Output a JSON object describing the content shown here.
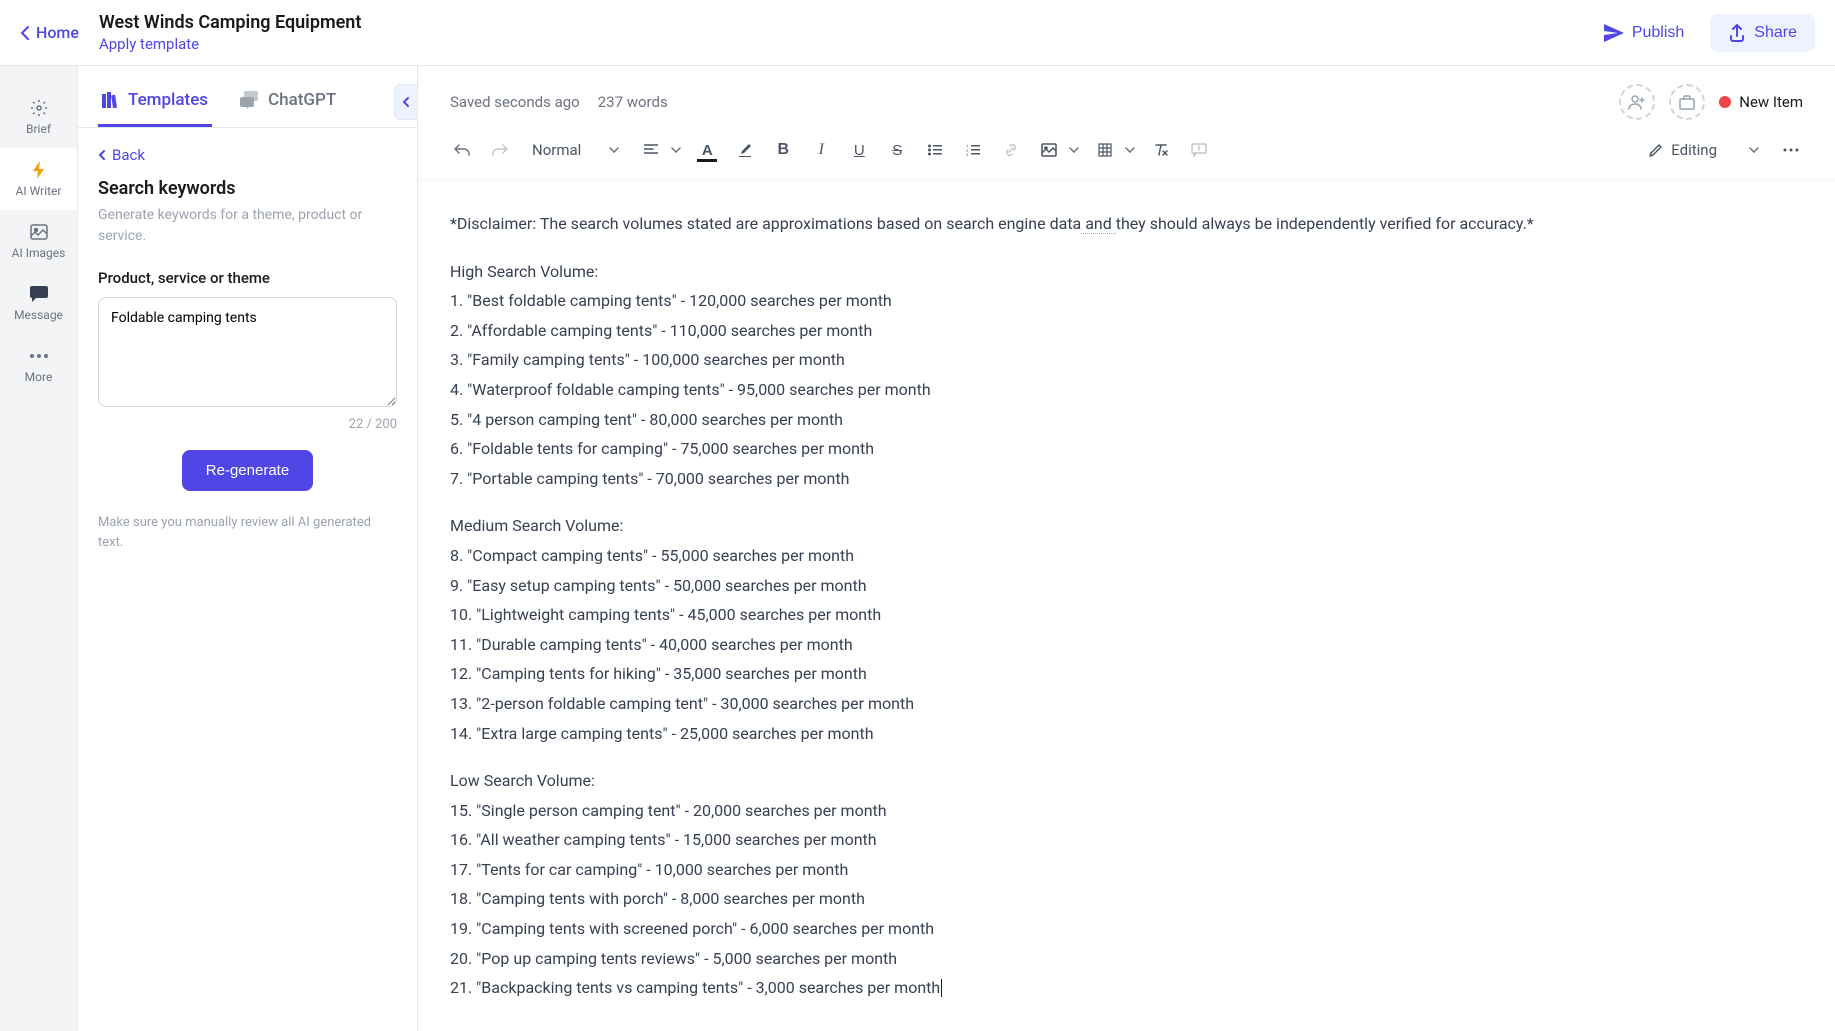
{
  "header": {
    "home": "Home",
    "title": "West Winds Camping Equipment",
    "apply_template": "Apply template",
    "publish": "Publish",
    "share": "Share"
  },
  "rail": {
    "brief": "Brief",
    "ai_writer": "AI Writer",
    "ai_images": "AI Images",
    "message": "Message",
    "more": "More"
  },
  "panel": {
    "tabs": {
      "templates": "Templates",
      "chatgpt": "ChatGPT"
    },
    "back": "Back",
    "section_title": "Search keywords",
    "section_desc": "Generate keywords for a theme, product or service.",
    "input_label": "Product, service or theme",
    "input_value": "Foldable camping tents",
    "char_count": "22 / 200",
    "regenerate": "Re-generate",
    "review_note": "Make sure you manually review all AI generated text."
  },
  "editor": {
    "saved_status": "Saved seconds ago",
    "word_count": "237 words",
    "new_item": "New Item",
    "style_select": "Normal",
    "mode": "Editing"
  },
  "content": {
    "disclaimer_a": "*Disclaimer: The search volumes stated are approximations based on search engine data",
    "disclaimer_mid": " and ",
    "disclaimer_b": "they should always be independently verified for accuracy.*",
    "high_heading": "High Search Volume:",
    "high": [
      "1. \"Best foldable camping tents\" - 120,000 searches per month",
      "2. \"Affordable camping tents\" - 110,000 searches per month",
      "3. \"Family camping tents\" - 100,000 searches per month",
      "4. \"Waterproof foldable camping tents\" - 95,000 searches per month",
      "5. \"4 person camping tent\" - 80,000 searches per month",
      "6. \"Foldable tents for camping\" - 75,000 searches per month",
      "7. \"Portable camping tents\" - 70,000 searches per month"
    ],
    "medium_heading": "Medium Search Volume:",
    "medium": [
      "8. \"Compact camping tents\" - 55,000 searches per month",
      "9. \"Easy setup camping tents\" - 50,000 searches per month",
      "10. \"Lightweight camping tents\" - 45,000 searches per month",
      "11. \"Durable camping tents\" - 40,000 searches per month",
      "12. \"Camping tents for hiking\" - 35,000 searches per month",
      "13. \"2-person foldable camping tent\" - 30,000 searches per month",
      "14. \"Extra large camping tents\" - 25,000 searches per month"
    ],
    "low_heading": "Low Search Volume:",
    "low": [
      "15. \"Single person camping tent\" - 20,000 searches per month",
      "16. \"All weather camping tents\" - 15,000 searches per month",
      "17. \"Tents for car camping\" - 10,000 searches per month",
      "18. \"Camping tents with porch\" - 8,000 searches per month",
      "19. \"Camping tents with screened porch\" - 6,000 searches per month",
      "20. \"Pop up camping tents reviews\" - 5,000 searches per month",
      "21. \"Backpacking tents vs camping tents\" - 3,000 searches per month"
    ]
  }
}
